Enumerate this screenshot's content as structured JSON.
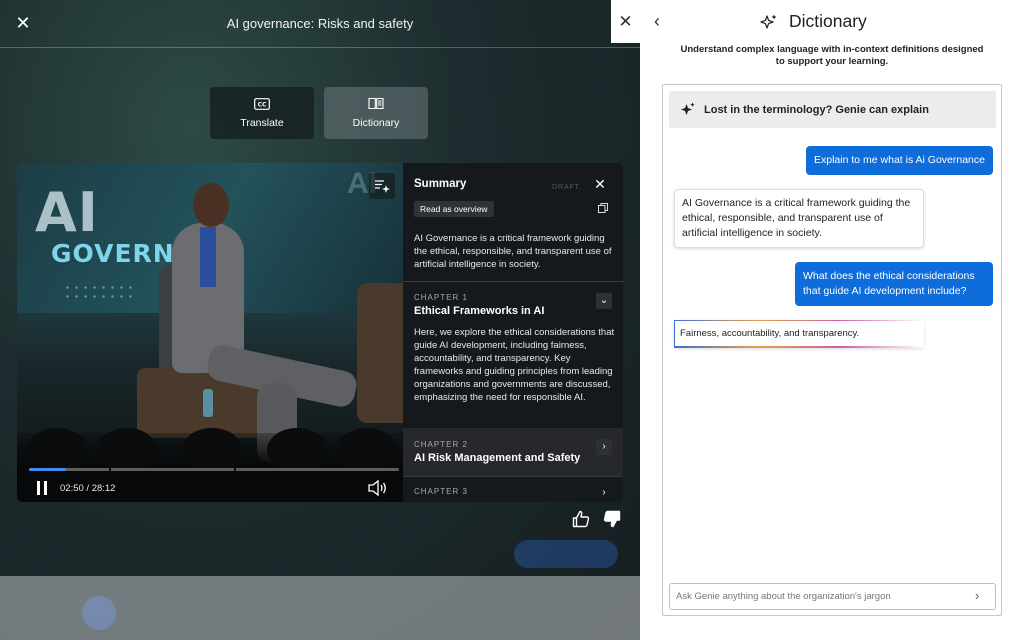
{
  "video": {
    "title": "AI governance: Risks and safety",
    "close_icon": "close-icon",
    "tools": [
      {
        "label": "Translate",
        "icon": "closed-captions-icon"
      },
      {
        "label": "Dictionary",
        "icon": "book-icon"
      }
    ],
    "screen_text": {
      "ai": "AI",
      "govern": "GOVERN",
      "ai_right": "AI"
    },
    "player": {
      "time": "02:50 / 28:12",
      "progress": 0.1005,
      "accent": "#3d8bf5"
    },
    "summary": {
      "title": "Summary",
      "badge": "DRAFT",
      "read_overview": "Read as overview",
      "text": "AI Governance is a critical framework guiding the ethical, responsible, and transparent use of artificial intelligence in society.",
      "chapters": [
        {
          "label": "CHAPTER 1",
          "title": "Ethical Frameworks in AI",
          "text": "Here, we explore the ethical considerations that guide AI development, including fairness, accountability, and transparency. Key frameworks and guiding principles from leading organizations and governments are discussed, emphasizing the need for responsible AI."
        },
        {
          "label": "CHAPTER 2",
          "title": "AI Risk Management and Safety"
        },
        {
          "label": "CHAPTER 3"
        }
      ]
    }
  },
  "dictionary": {
    "title": "Dictionary",
    "subtitle": "Understand complex language with in-context definitions designed to support your learning.",
    "banner": "Lost in the terminology? Genie can explain",
    "messages": [
      {
        "role": "user",
        "text": "Explain to me what is Ai Governance"
      },
      {
        "role": "bot",
        "text": "AI Governance is a critical framework guiding the ethical, responsible, and transparent use of artificial intelligence in society."
      },
      {
        "role": "user",
        "text": "What does the ethical considerations that guide AI development include?"
      },
      {
        "role": "bot",
        "text": "Fairness, accountability, and transparency."
      }
    ],
    "input_placeholder": "Ask Genie anything about the organization's jargon",
    "accent": "#0f6cdb"
  }
}
